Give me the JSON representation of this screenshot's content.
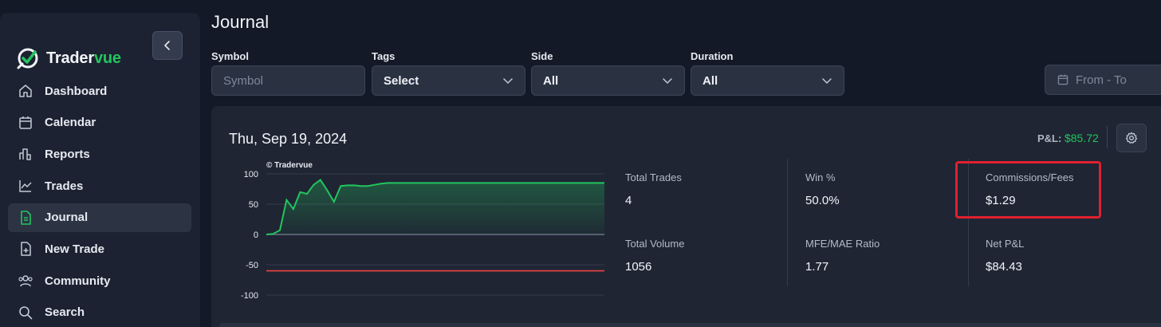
{
  "app": {
    "name_main": "Trader",
    "name_accent": "vue",
    "accent_color": "#22c55e",
    "positive_color": "#22c55e",
    "negative_color": "#ef4444"
  },
  "sidebar": {
    "items": [
      {
        "label": "Dashboard",
        "icon": "home-icon",
        "active": false
      },
      {
        "label": "Calendar",
        "icon": "calendar-icon",
        "active": false
      },
      {
        "label": "Reports",
        "icon": "bar-chart-icon",
        "active": false
      },
      {
        "label": "Trades",
        "icon": "line-chart-icon",
        "active": false
      },
      {
        "label": "Journal",
        "icon": "journal-icon",
        "active": true
      },
      {
        "label": "New Trade",
        "icon": "file-plus-icon",
        "active": false
      },
      {
        "label": "Community",
        "icon": "users-icon",
        "active": false
      },
      {
        "label": "Search",
        "icon": "search-icon",
        "active": false
      }
    ]
  },
  "header": {
    "title": "Journal"
  },
  "filters": {
    "symbol": {
      "label": "Symbol",
      "placeholder": "Symbol"
    },
    "tags": {
      "label": "Tags",
      "value": "Select"
    },
    "side": {
      "label": "Side",
      "value": "All"
    },
    "duration": {
      "label": "Duration",
      "value": "All"
    },
    "date_range": {
      "placeholder": "From - To"
    }
  },
  "journal_entry": {
    "date": "Thu, Sep 19, 2024",
    "pl_label": "P&L:",
    "pl_value": "$85.72",
    "chart_watermark": "© Tradervue",
    "stats": {
      "total_trades": {
        "label": "Total Trades",
        "value": "4"
      },
      "win_pct": {
        "label": "Win %",
        "value": "50.0%"
      },
      "commissions": {
        "label": "Commissions/Fees",
        "value": "$1.29"
      },
      "total_volume": {
        "label": "Total Volume",
        "value": "1056"
      },
      "mfe_mae": {
        "label": "MFE/MAE Ratio",
        "value": "1.77"
      },
      "net_pl": {
        "label": "Net P&L",
        "value": "$84.43"
      }
    }
  },
  "chart_data": {
    "type": "area",
    "title": "",
    "xlabel": "",
    "ylabel": "",
    "ylim": [
      -100,
      100
    ],
    "y_ticks": [
      "100",
      "50",
      "0",
      "-50",
      "-100"
    ],
    "grid": true,
    "series": [
      {
        "values": [
          0,
          1,
          7,
          57,
          42,
          70,
          67,
          82,
          90,
          73,
          54,
          80,
          81,
          81,
          80,
          80,
          82,
          84,
          85,
          85,
          85,
          85,
          85,
          85,
          85,
          85,
          85,
          85,
          85,
          85,
          85,
          85,
          85,
          85,
          85,
          85,
          85,
          85,
          85,
          85,
          85,
          85,
          85,
          85,
          85,
          85,
          85,
          85,
          85,
          85,
          85
        ]
      }
    ],
    "reference_line": -60
  }
}
